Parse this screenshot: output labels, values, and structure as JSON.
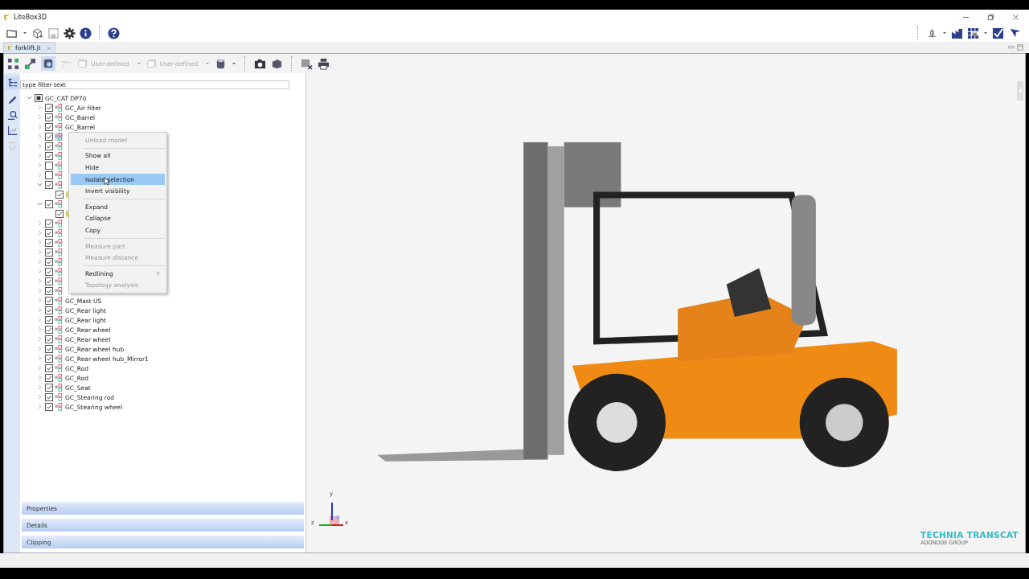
{
  "window": {
    "title": "LiteBox3D"
  },
  "tab": {
    "label": "forklift.jt",
    "selected": true
  },
  "view_toolbar": {
    "dropdowns": [
      {
        "label": "User-defined",
        "disabled": true
      },
      {
        "label": "User-defined",
        "disabled": true
      }
    ]
  },
  "filter": {
    "placeholder": "type filter text"
  },
  "tree": [
    {
      "label": "GC_CAT DP70",
      "checked": true,
      "partial": true,
      "expanded": true,
      "selected": false,
      "children": [
        {
          "label": "GC_Air filter",
          "kind": "assembly",
          "checked": true,
          "expanded": false,
          "selected": false
        },
        {
          "label": "GC_Barrel",
          "kind": "assembly",
          "checked": true,
          "expanded": false,
          "selected": false
        },
        {
          "label": "GC_Barrel",
          "kind": "assembly",
          "checked": true,
          "expanded": false,
          "selected": false
        },
        {
          "kind": "assembly",
          "checked": true,
          "expanded": false,
          "selected": true
        },
        {
          "kind": "assembly",
          "checked": true,
          "expanded": false,
          "selected": false
        },
        {
          "kind": "assembly",
          "checked": true,
          "expanded": false,
          "selected": false
        },
        {
          "kind": "assembly",
          "checked": false,
          "expanded": false,
          "selected": false
        },
        {
          "kind": "assembly",
          "checked": false,
          "expanded": false,
          "selected": false
        },
        {
          "kind": "assembly",
          "checked": true,
          "expanded": true,
          "selected": false,
          "children": [
            {
              "kind": "part",
              "checked": true
            }
          ]
        },
        {
          "kind": "assembly",
          "checked": true,
          "expanded": true,
          "selected": false,
          "children": [
            {
              "kind": "part",
              "checked": true
            }
          ]
        },
        {
          "kind": "assembly",
          "checked": true,
          "expanded": false,
          "selected": false
        },
        {
          "kind": "assembly",
          "checked": true,
          "expanded": false,
          "selected": false
        },
        {
          "kind": "assembly",
          "checked": true,
          "expanded": false,
          "selected": false
        },
        {
          "kind": "assembly",
          "checked": true,
          "expanded": false,
          "selected": false
        },
        {
          "kind": "assembly",
          "checked": true,
          "expanded": false,
          "selected": false
        },
        {
          "kind": "assembly",
          "checked": true,
          "expanded": false,
          "selected": false
        },
        {
          "kind": "assembly",
          "checked": true,
          "expanded": false,
          "selected": false
        },
        {
          "kind": "assembly",
          "checked": true,
          "expanded": false,
          "selected": false
        },
        {
          "label": "GC_Mast US",
          "kind": "assembly",
          "checked": true,
          "expanded": false,
          "selected": false
        },
        {
          "label": "GC_Rear light",
          "kind": "assembly",
          "checked": true,
          "expanded": false,
          "selected": false
        },
        {
          "label": "GC_Rear light",
          "kind": "assembly",
          "checked": true,
          "expanded": false,
          "selected": false
        },
        {
          "label": "GC_Rear wheel",
          "kind": "assembly",
          "checked": true,
          "expanded": false,
          "selected": false
        },
        {
          "label": "GC_Rear wheel",
          "kind": "assembly",
          "checked": true,
          "expanded": false,
          "selected": false
        },
        {
          "label": "GC_Rear wheel hub",
          "kind": "assembly",
          "checked": true,
          "expanded": false,
          "selected": false
        },
        {
          "label": "GC_Rear wheel hub_Mirror1",
          "kind": "assembly",
          "checked": true,
          "expanded": false,
          "selected": false
        },
        {
          "label": "GC_Rod",
          "kind": "assembly",
          "checked": true,
          "expanded": false,
          "selected": false
        },
        {
          "label": "GC_Rod",
          "kind": "assembly",
          "checked": true,
          "expanded": false,
          "selected": false
        },
        {
          "label": "GC_Seat",
          "kind": "assembly",
          "checked": true,
          "expanded": false,
          "selected": false
        },
        {
          "label": "GC_Stearing rod",
          "kind": "assembly",
          "checked": true,
          "expanded": false,
          "selected": false
        },
        {
          "label": "GC_Stearing wheel",
          "kind": "assembly",
          "checked": true,
          "expanded": false,
          "selected": false
        }
      ]
    }
  ],
  "context_menu": [
    {
      "kind": "item",
      "label": "Unload model",
      "disabled": true,
      "selected": false
    },
    {
      "kind": "separator"
    },
    {
      "kind": "item",
      "label": "Show all",
      "disabled": false,
      "selected": false
    },
    {
      "kind": "item",
      "label": "Hide",
      "disabled": false,
      "selected": false
    },
    {
      "kind": "item",
      "label": "Isolate selection",
      "disabled": false,
      "selected": true
    },
    {
      "kind": "item",
      "label": "Invert visibility",
      "disabled": false,
      "selected": false
    },
    {
      "kind": "separator"
    },
    {
      "kind": "item",
      "label": "Expand",
      "disabled": false,
      "selected": false
    },
    {
      "kind": "item",
      "label": "Collapse",
      "disabled": false,
      "selected": false
    },
    {
      "kind": "item",
      "label": "Copy",
      "disabled": false,
      "selected": false
    },
    {
      "kind": "separator"
    },
    {
      "kind": "item",
      "label": "Measure part",
      "disabled": true,
      "selected": false
    },
    {
      "kind": "item",
      "label": "Measure distance",
      "disabled": true,
      "selected": false
    },
    {
      "kind": "separator"
    },
    {
      "kind": "item",
      "label": "Redlining",
      "disabled": false,
      "selected": false,
      "submenu": true
    },
    {
      "kind": "item",
      "label": "Topology analysis",
      "disabled": true,
      "selected": false
    }
  ],
  "panels": [
    {
      "label": "Properties"
    },
    {
      "label": "Details"
    },
    {
      "label": "Clipping"
    }
  ],
  "axis_triad": {
    "y": "y",
    "z": "z",
    "x": "x"
  },
  "logo": {
    "name": "TECHNIA TRANSCAT",
    "tagline": "ADDNODE GROUP"
  }
}
